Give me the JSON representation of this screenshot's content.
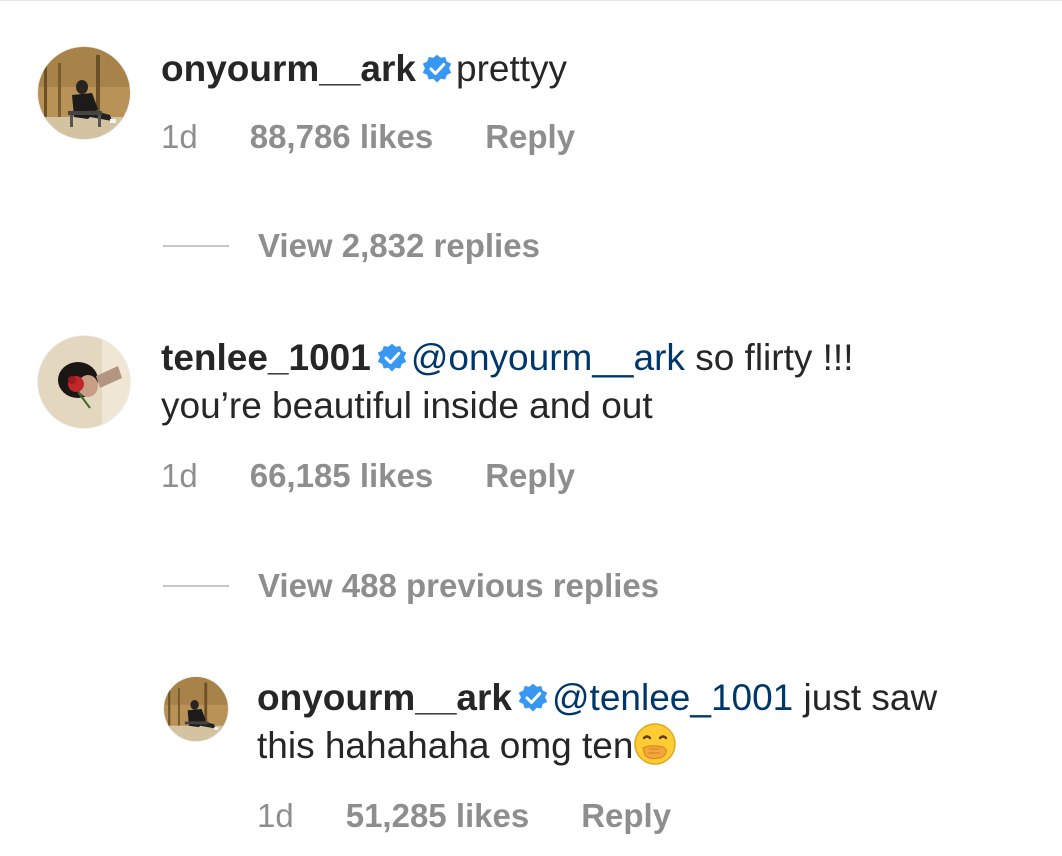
{
  "colors": {
    "text": "#262626",
    "secondary": "#8e8e8e",
    "mention": "#00376b",
    "verified": "#3897f0",
    "divider": "#c7c7c7"
  },
  "comments": [
    {
      "username": "onyourm__ark",
      "verified": true,
      "mention": "",
      "text": "prettyy",
      "time": "1d",
      "likes": "88,786 likes",
      "reply_label": "Reply",
      "view_replies": "View 2,832 replies"
    },
    {
      "username": "tenlee_1001",
      "verified": true,
      "mention": "@onyourm__ark",
      "text": "so flirty !!!",
      "text_line2": "you’re beautiful inside and out",
      "time": "1d",
      "likes": "66,185 likes",
      "reply_label": "Reply",
      "view_replies": "View 488 previous replies"
    }
  ],
  "reply": {
    "username": "onyourm__ark",
    "verified": true,
    "mention": "@tenlee_1001",
    "text": "just saw",
    "text_line2": "this hahahaha omg ten",
    "emoji": "face-with-hand-over-mouth",
    "time": "1d",
    "likes": "51,285 likes",
    "reply_label": "Reply"
  }
}
